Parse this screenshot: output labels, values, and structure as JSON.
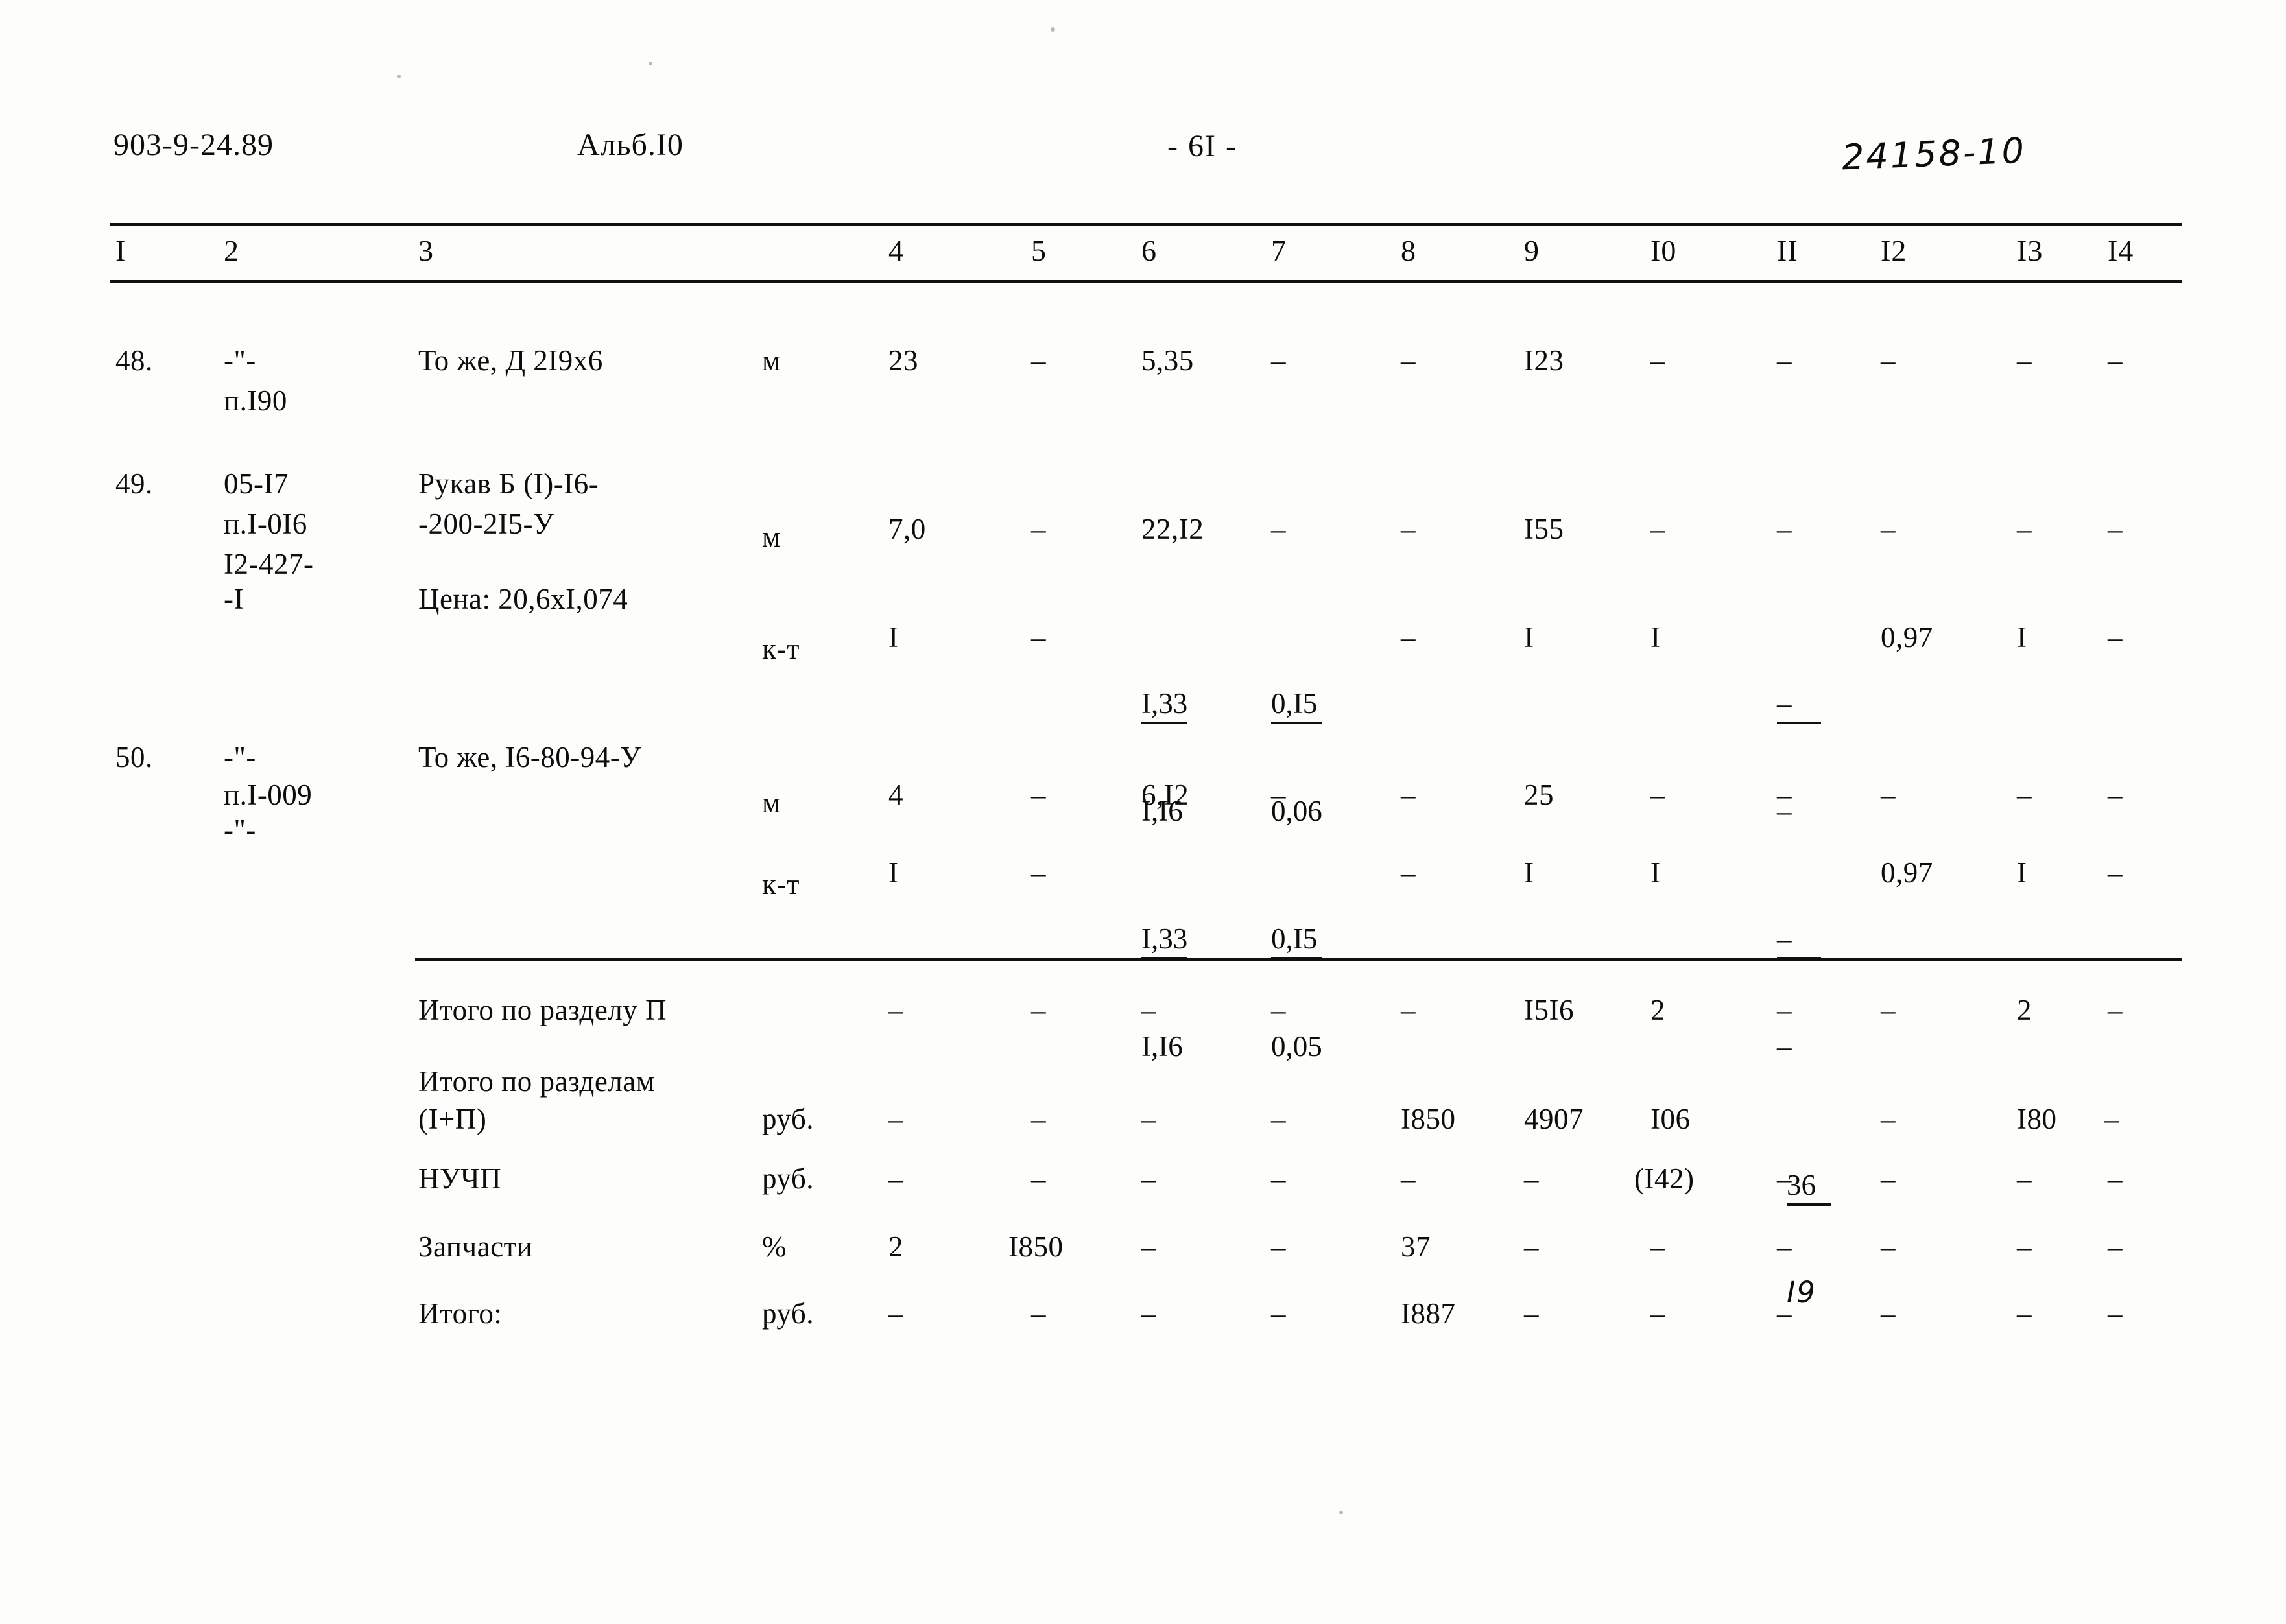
{
  "header": {
    "doc_code": "903-9-24.89",
    "album": "Альб.I0",
    "page_number": "- 6I -",
    "handwritten_note": "24158-10"
  },
  "table": {
    "column_headers": [
      "I",
      "2",
      "3",
      "4",
      "5",
      "6",
      "7",
      "8",
      "9",
      "I0",
      "II",
      "I2",
      "I3",
      "I4"
    ],
    "rows": [
      {
        "num": "48.",
        "code_lines": [
          "-\"-",
          "п.I90"
        ],
        "desc_lines": [
          "То же, Д 2I9х6"
        ],
        "unit": "м",
        "c4": "23",
        "c5": "–",
        "c6": "5,35",
        "c7": "–",
        "c8": "–",
        "c9": "I23",
        "c10": "–",
        "c11": "–",
        "c12": "–",
        "c13": "–",
        "c14": "–"
      },
      {
        "num": "49.",
        "code_lines": [
          "05-I7",
          "п.I-0I6",
          "I2-427-",
          "-I"
        ],
        "desc_lines": [
          "Рукав Б (I)-I6-",
          "-200-2I5-У"
        ],
        "price_line": "Цена: 20,6хI,074",
        "unit": "м",
        "c4": "7,0",
        "c5": "–",
        "c6": "22,I2",
        "c7": "–",
        "c8": "–",
        "c9": "I55",
        "c10": "–",
        "c11": "–",
        "c12": "–",
        "c13": "–",
        "c14": "–",
        "sub": {
          "unit": "к-т",
          "c4": "I",
          "c5": "–",
          "c6_num": "I,33",
          "c6_den": "I,I6",
          "c7_num": "0,I5",
          "c7_den": "0,06",
          "c8": "–",
          "c9": "I",
          "c10": "I",
          "c11_num": "–",
          "c11_den": "–",
          "c12": "0,97",
          "c13": "I",
          "c14": "–"
        }
      },
      {
        "num": "50.",
        "code_lines": [
          "-\"-",
          "п.I-009",
          "-\"-"
        ],
        "desc_lines": [
          "То же, I6-80-94-У"
        ],
        "unit": "м",
        "c4": "4",
        "c5": "–",
        "c6": "6,I2",
        "c7": "–",
        "c8": "–",
        "c9": "25",
        "c10": "–",
        "c11": "–",
        "c12": "–",
        "c13": "–",
        "c14": "–",
        "sub": {
          "unit": "к-т",
          "c4": "I",
          "c5": "–",
          "c6_num": "I,33",
          "c6_den": "I,I6",
          "c7_num": "0,I5",
          "c7_den": "0,05",
          "c8": "–",
          "c9": "I",
          "c10": "I",
          "c11_num": "–",
          "c11_den": "–",
          "c12": "0,97",
          "c13": "I",
          "c14": "–"
        }
      }
    ],
    "totals": [
      {
        "label": "Итого по разделу П",
        "unit": "",
        "c4": "–",
        "c5": "–",
        "c6": "–",
        "c7": "–",
        "c8": "–",
        "c9": "I5I6",
        "c10": "2",
        "c11": "–",
        "c12": "–",
        "c13": "2",
        "c14": "–"
      },
      {
        "label_line1": "Итого по разделам",
        "label_line2": "(I+П)",
        "unit": "руб.",
        "c4": "–",
        "c5": "–",
        "c6": "–",
        "c7": "–",
        "c8": "I850",
        "c9": "4907",
        "c10": "I06",
        "c11_num": "36",
        "c11_den": "I9",
        "c12": "–",
        "c13": "I80",
        "c14": "–"
      },
      {
        "label": "НУЧП",
        "unit": "руб.",
        "c4": "–",
        "c5": "–",
        "c6": "–",
        "c7": "–",
        "c8": "–",
        "c9": "–",
        "c10": "(I42)",
        "c11": "–",
        "c12": "–",
        "c13": "–",
        "c14": "–"
      },
      {
        "label": "Запчасти",
        "unit": "%",
        "c4": "2",
        "c5": "I850",
        "c6": "–",
        "c7": "–",
        "c8": "37",
        "c9": "–",
        "c10": "–",
        "c11": "–",
        "c12": "–",
        "c13": "–",
        "c14": "–"
      },
      {
        "label": "Итого:",
        "unit": "руб.",
        "c4": "–",
        "c5": "–",
        "c6": "–",
        "c7": "–",
        "c8": "I887",
        "c9": "–",
        "c10": "–",
        "c11": "–",
        "c12": "–",
        "c13": "–",
        "c14": "–"
      }
    ]
  }
}
